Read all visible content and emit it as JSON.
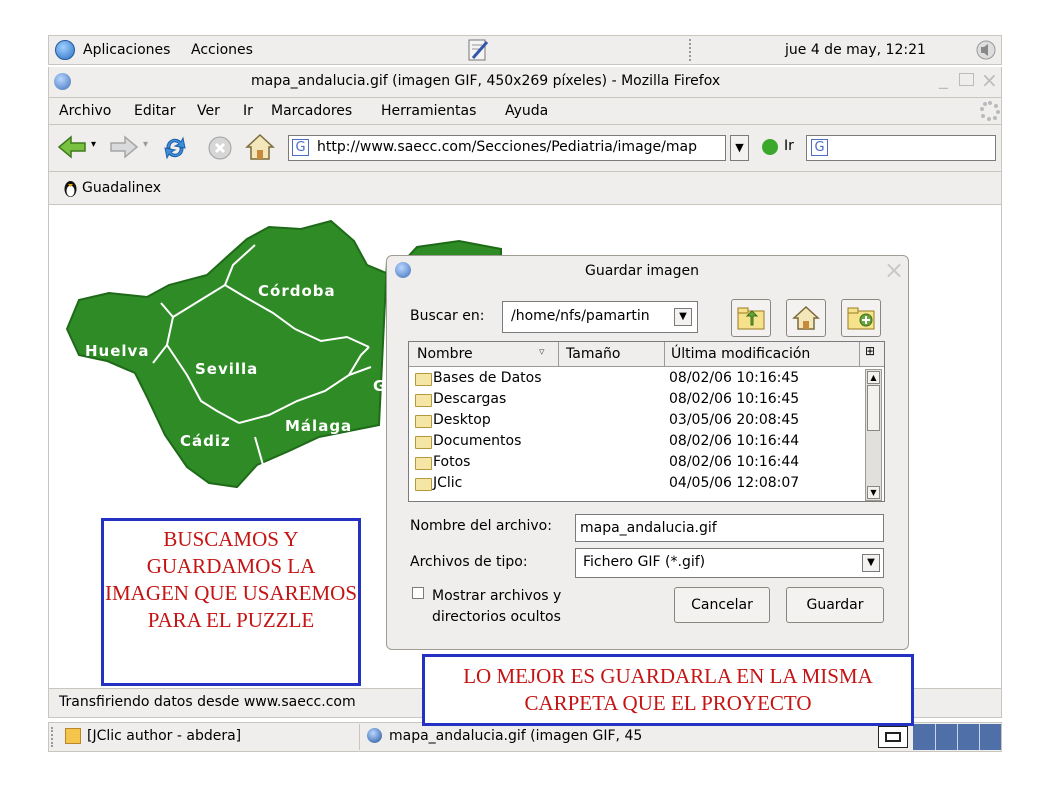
{
  "panel": {
    "applications": "Aplicaciones",
    "actions": "Acciones",
    "clock": "jue  4 de may, 12:21"
  },
  "window": {
    "title": "mapa_andalucia.gif (imagen GIF, 450x269 píxeles) - Mozilla Firefox"
  },
  "menu": {
    "items": [
      "Archivo",
      "Editar",
      "Ver",
      "Ir",
      "Marcadores",
      "Herramientas",
      "Ayuda"
    ]
  },
  "nav": {
    "url": "http://www.saecc.com/Secciones/Pediatria/image/map",
    "go_label": "Ir"
  },
  "bookmarks": {
    "guadalinex": "Guadalinex"
  },
  "map": {
    "color": "#2e8b25",
    "labels": [
      "Huelva",
      "Córdoba",
      "Sevilla",
      "Cádiz",
      "Málaga",
      "G"
    ]
  },
  "dialog": {
    "title": "Guardar imagen",
    "search_label": "Buscar en:",
    "search_path": "/home/nfs/pamartin",
    "columns": [
      "Nombre",
      "Tamaño",
      "Última modificación"
    ],
    "files": [
      {
        "name": "Bases de Datos",
        "date": "08/02/06 10:16:45"
      },
      {
        "name": "Descargas",
        "date": "08/02/06 10:16:45"
      },
      {
        "name": "Desktop",
        "date": "03/05/06 20:08:45"
      },
      {
        "name": "Documentos",
        "date": "08/02/06 10:16:44"
      },
      {
        "name": "Fotos",
        "date": "08/02/06 10:16:44"
      },
      {
        "name": "JClic",
        "date": "04/05/06 12:08:07"
      }
    ],
    "filename_label": "Nombre del archivo:",
    "filename_value": "mapa_andalucia.gif",
    "filetype_label": "Archivos de tipo:",
    "filetype_value": "Fichero GIF (*.gif)",
    "hidden_checkbox_label": "Mostrar archivos y directorios ocultos",
    "cancel_label": "Cancelar",
    "save_label": "Guardar"
  },
  "status": {
    "text": "Transfiriendo datos desde www.saecc.com"
  },
  "taskbar": {
    "items": [
      "[JClic author - abdera]",
      "mapa_andalucia.gif (imagen GIF, 45"
    ]
  },
  "annotations": {
    "left_note": "BUSCAMOS Y GUARDAMOS LA IMAGEN QUE USAREMOS PARA EL PUZZLE",
    "right_note": "LO MEJOR ES GUARDARLA EN LA MISMA CARPETA QUE EL PROYECTO",
    "note_border_color": "#2432c4",
    "note_text_color": "#c41414"
  }
}
